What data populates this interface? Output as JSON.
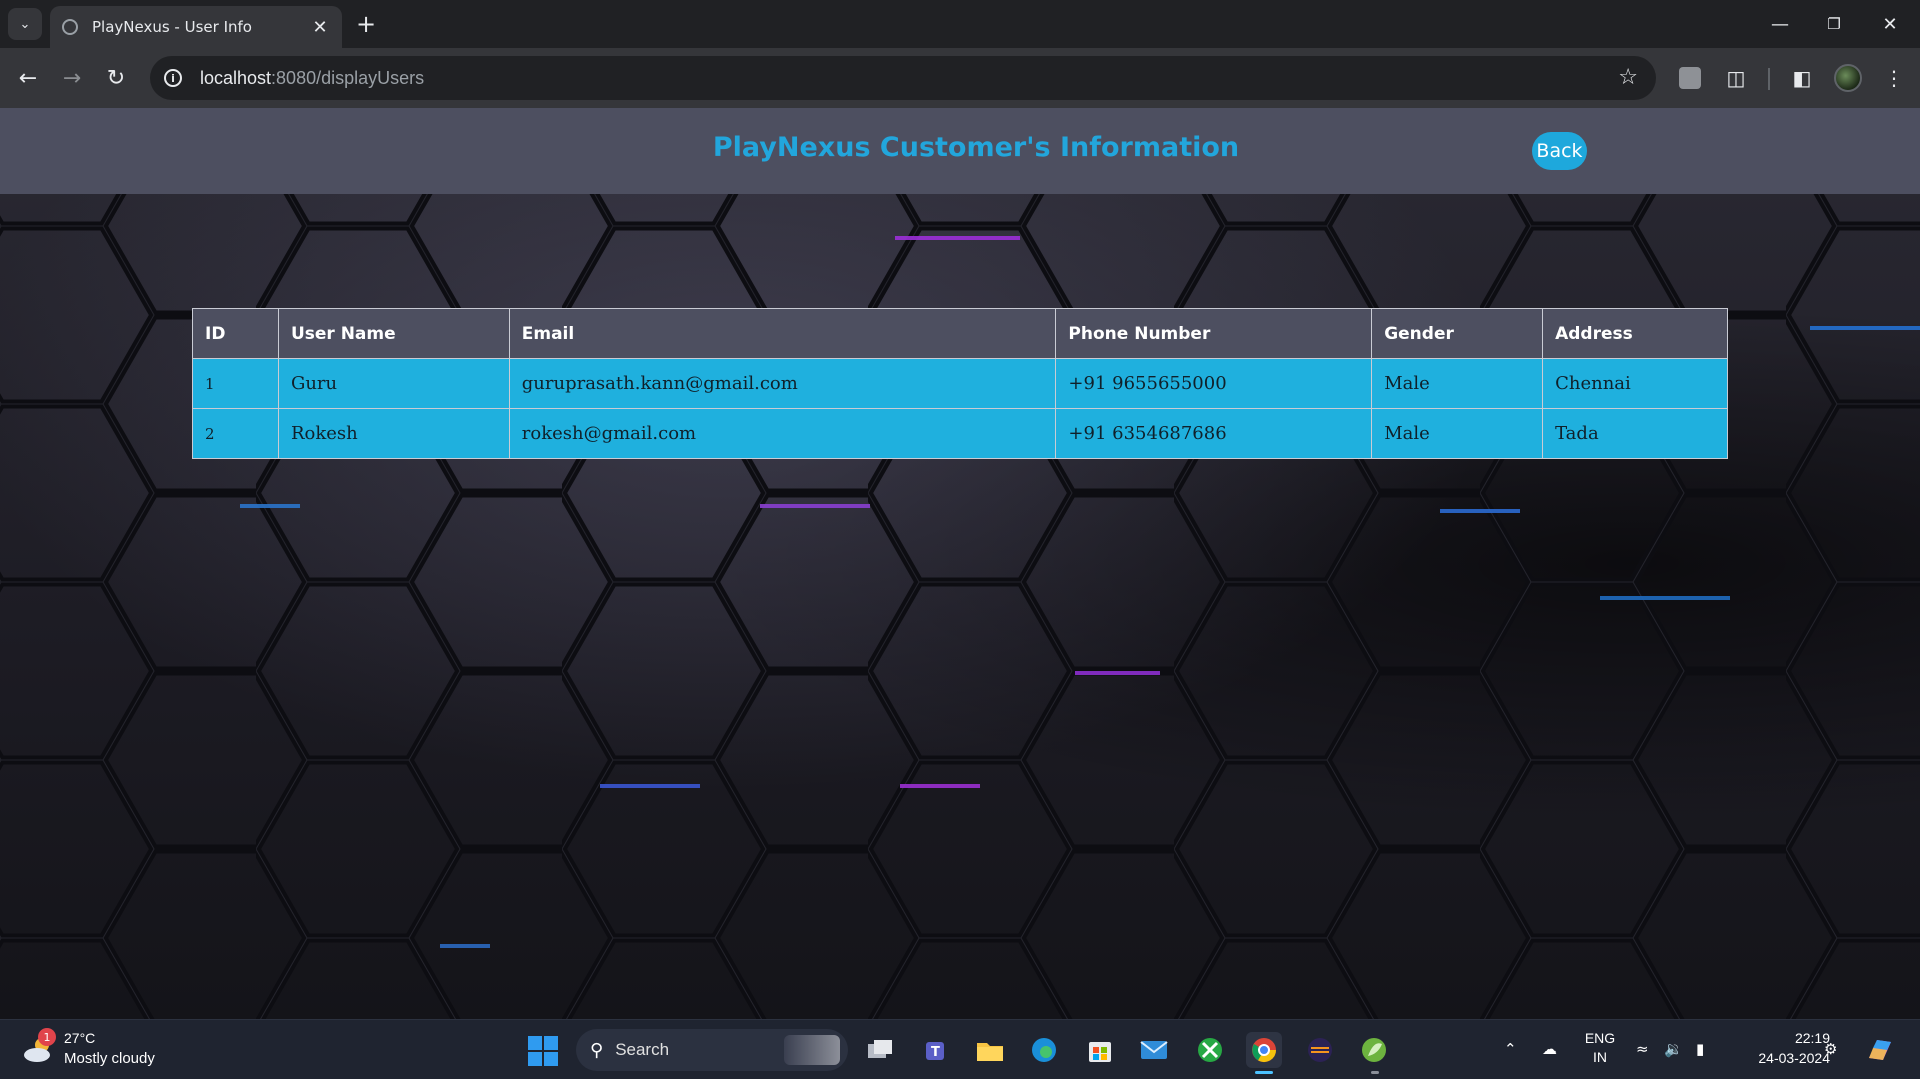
{
  "browser": {
    "tab_title": "PlayNexus - User Info",
    "url_host": "localhost",
    "url_path": ":8080/displayUsers"
  },
  "page": {
    "title": "PlayNexus Customer's Information",
    "back_label": "Back"
  },
  "table": {
    "headers": [
      "ID",
      "User Name",
      "Email",
      "Phone Number",
      "Gender",
      "Address"
    ],
    "rows": [
      [
        "1",
        "Guru",
        "guruprasath.kann@gmail.com",
        "+91 9655655000",
        "Male",
        "Chennai"
      ],
      [
        "2",
        "Rokesh",
        "rokesh@gmail.com",
        "+91 6354687686",
        "Male",
        "Tada"
      ]
    ]
  },
  "taskbar": {
    "weather_badge": "1",
    "weather_temp": "27°C",
    "weather_desc": "Mostly cloudy",
    "search_label": "Search",
    "lang_line1": "ENG",
    "lang_line2": "IN",
    "time": "22:19",
    "date": "24-03-2024"
  },
  "colors": {
    "accent": "#1fb0de",
    "header_bg": "#4d4f60",
    "title": "#22a6dc"
  },
  "icons": [
    "tab-search-icon",
    "globe-icon",
    "close-icon",
    "plus-icon",
    "minimize-icon",
    "restore-icon",
    "window-close-icon",
    "back-arrow-icon",
    "forward-arrow-icon",
    "reload-icon",
    "site-info-icon",
    "star-icon",
    "puzzle-icon",
    "side-panel-icon",
    "more-icon",
    "windows-start-icon",
    "search-icon",
    "wifi-icon",
    "volume-icon",
    "battery-icon"
  ]
}
